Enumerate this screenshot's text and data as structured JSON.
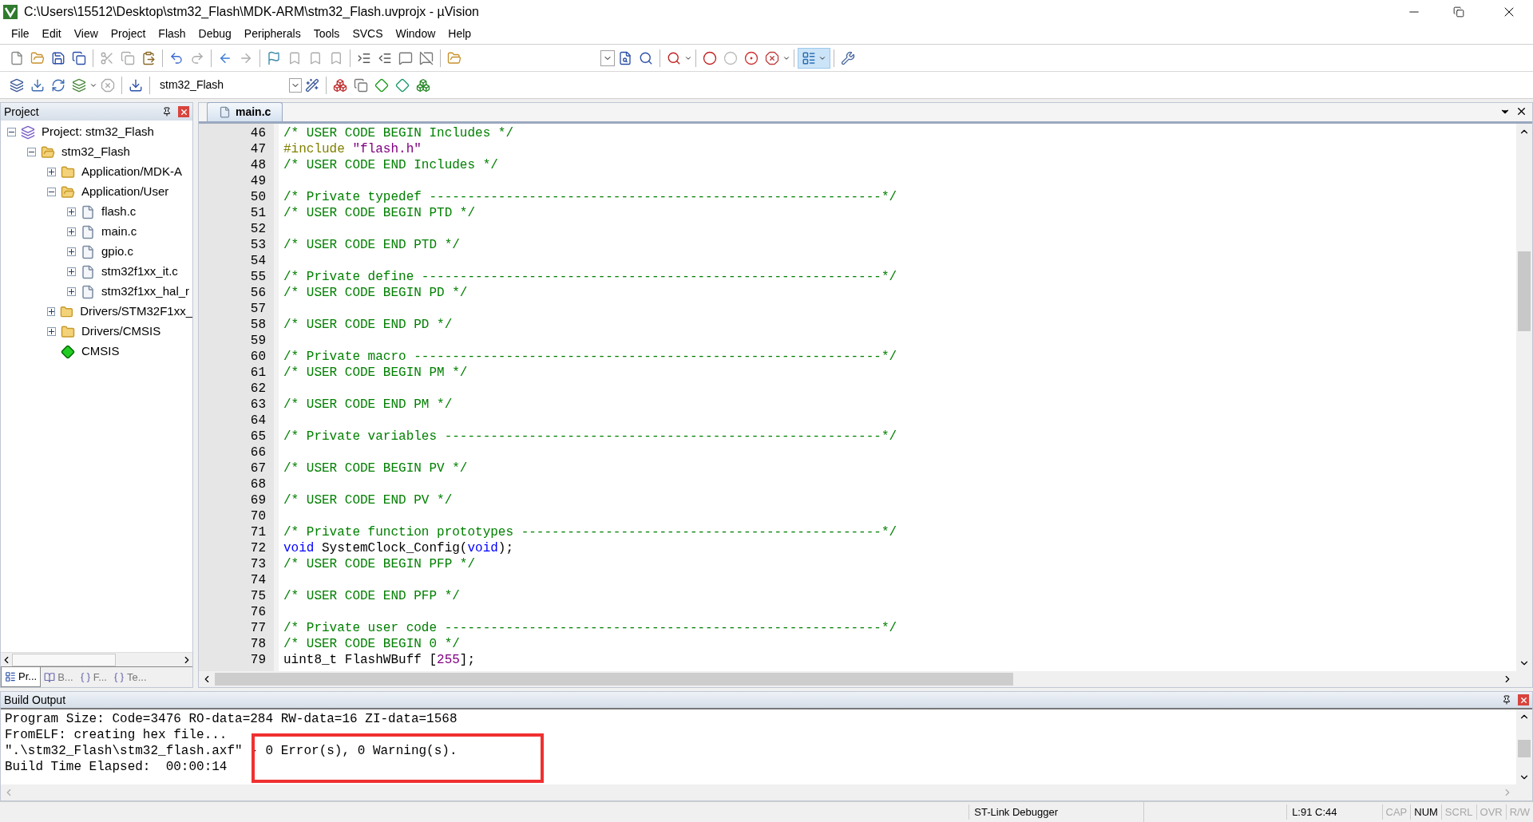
{
  "window": {
    "title": "C:\\Users\\15512\\Desktop\\stm32_Flash\\MDK-ARM\\stm32_Flash.uvprojx - µVision"
  },
  "menu": [
    "File",
    "Edit",
    "View",
    "Project",
    "Flash",
    "Debug",
    "Peripherals",
    "Tools",
    "SVCS",
    "Window",
    "Help"
  ],
  "toolbar": {
    "target": "stm32_Flash"
  },
  "project_panel": {
    "title": "Project",
    "tree": [
      {
        "kind": "project",
        "label": "Project: stm32_Flash",
        "expanded": true,
        "children": [
          {
            "kind": "target",
            "label": "stm32_Flash",
            "expanded": true,
            "children": [
              {
                "kind": "group",
                "label": "Application/MDK-A",
                "expanded": false
              },
              {
                "kind": "group",
                "label": "Application/User",
                "expanded": true,
                "children": [
                  {
                    "kind": "file",
                    "label": "flash.c",
                    "expanded": false
                  },
                  {
                    "kind": "file",
                    "label": "main.c",
                    "expanded": false
                  },
                  {
                    "kind": "file",
                    "label": "gpio.c",
                    "expanded": false
                  },
                  {
                    "kind": "file",
                    "label": "stm32f1xx_it.c",
                    "expanded": false
                  },
                  {
                    "kind": "file",
                    "label": "stm32f1xx_hal_r",
                    "expanded": false
                  }
                ]
              },
              {
                "kind": "group",
                "label": "Drivers/STM32F1xx_",
                "expanded": false
              },
              {
                "kind": "group",
                "label": "Drivers/CMSIS",
                "expanded": false
              },
              {
                "kind": "component",
                "label": "CMSIS"
              }
            ]
          }
        ]
      }
    ],
    "tabs": [
      {
        "kind": "project",
        "label": "Pr...",
        "selected": true
      },
      {
        "kind": "books",
        "label": "B...",
        "selected": false
      },
      {
        "kind": "functions",
        "label": "F...",
        "selected": false
      },
      {
        "kind": "templates",
        "label": "Te...",
        "selected": false
      }
    ]
  },
  "editor": {
    "tabs": [
      {
        "label": "main.c",
        "selected": true
      }
    ],
    "lines": [
      {
        "number": "46",
        "segments": [
          {
            "kind": "comment",
            "text": "/* USER CODE BEGIN Includes */"
          }
        ]
      },
      {
        "number": "47",
        "segments": [
          {
            "kind": "directive",
            "text": "#include "
          },
          {
            "kind": "string",
            "text": "\"flash.h\""
          }
        ]
      },
      {
        "number": "48",
        "segments": [
          {
            "kind": "comment",
            "text": "/* USER CODE END Includes */"
          }
        ]
      },
      {
        "number": "49"
      },
      {
        "number": "50",
        "segments": [
          {
            "kind": "comment",
            "text": "/* Private typedef -----------------------------------------------------------*/"
          }
        ]
      },
      {
        "number": "51",
        "segments": [
          {
            "kind": "comment",
            "text": "/* USER CODE BEGIN PTD */"
          }
        ]
      },
      {
        "number": "52"
      },
      {
        "number": "53",
        "segments": [
          {
            "kind": "comment",
            "text": "/* USER CODE END PTD */"
          }
        ]
      },
      {
        "number": "54"
      },
      {
        "number": "55",
        "segments": [
          {
            "kind": "comment",
            "text": "/* Private define ------------------------------------------------------------*/"
          }
        ]
      },
      {
        "number": "56",
        "segments": [
          {
            "kind": "comment",
            "text": "/* USER CODE BEGIN PD */"
          }
        ]
      },
      {
        "number": "57"
      },
      {
        "number": "58",
        "segments": [
          {
            "kind": "comment",
            "text": "/* USER CODE END PD */"
          }
        ]
      },
      {
        "number": "59"
      },
      {
        "number": "60",
        "segments": [
          {
            "kind": "comment",
            "text": "/* Private macro -------------------------------------------------------------*/"
          }
        ]
      },
      {
        "number": "61",
        "segments": [
          {
            "kind": "comment",
            "text": "/* USER CODE BEGIN PM */"
          }
        ]
      },
      {
        "number": "62"
      },
      {
        "number": "63",
        "segments": [
          {
            "kind": "comment",
            "text": "/* USER CODE END PM */"
          }
        ]
      },
      {
        "number": "64"
      },
      {
        "number": "65",
        "segments": [
          {
            "kind": "comment",
            "text": "/* Private variables ---------------------------------------------------------*/"
          }
        ]
      },
      {
        "number": "66"
      },
      {
        "number": "67",
        "segments": [
          {
            "kind": "comment",
            "text": "/* USER CODE BEGIN PV */"
          }
        ]
      },
      {
        "number": "68"
      },
      {
        "number": "69",
        "segments": [
          {
            "kind": "comment",
            "text": "/* USER CODE END PV */"
          }
        ]
      },
      {
        "number": "70"
      },
      {
        "number": "71",
        "segments": [
          {
            "kind": "comment",
            "text": "/* Private function prototypes -----------------------------------------------*/"
          }
        ]
      },
      {
        "number": "72",
        "segments": [
          {
            "kind": "keyword",
            "text": "void"
          },
          {
            "kind": "plain",
            "text": " SystemClock_Config("
          },
          {
            "kind": "keyword",
            "text": "void"
          },
          {
            "kind": "plain",
            "text": ");"
          }
        ]
      },
      {
        "number": "73",
        "segments": [
          {
            "kind": "comment",
            "text": "/* USER CODE BEGIN PFP */"
          }
        ]
      },
      {
        "number": "74"
      },
      {
        "number": "75",
        "segments": [
          {
            "kind": "comment",
            "text": "/* USER CODE END PFP */"
          }
        ]
      },
      {
        "number": "76"
      },
      {
        "number": "77",
        "segments": [
          {
            "kind": "comment",
            "text": "/* Private user code ---------------------------------------------------------*/"
          }
        ]
      },
      {
        "number": "78",
        "segments": [
          {
            "kind": "comment",
            "text": "/* USER CODE BEGIN 0 */"
          }
        ]
      },
      {
        "number": "79",
        "segments": [
          {
            "kind": "plain",
            "text": "uint8_t FlashWBuff ["
          },
          {
            "kind": "number",
            "text": "255"
          },
          {
            "kind": "plain",
            "text": "];"
          }
        ]
      }
    ]
  },
  "build_output": {
    "title": "Build Output",
    "lines": [
      "Program Size: Code=3476 RO-data=284 RW-data=16 ZI-data=1568",
      "FromELF: creating hex file...",
      "\".\\stm32_Flash\\stm32_flash.axf\" - 0 Error(s), 0 Warning(s).",
      "Build Time Elapsed:  00:00:14"
    ]
  },
  "status_bar": {
    "debugger": "ST-Link Debugger",
    "position": "L:91 C:44",
    "indicators": [
      {
        "label": "CAP",
        "on": false
      },
      {
        "label": "NUM",
        "on": true
      },
      {
        "label": "SCRL",
        "on": false
      },
      {
        "label": "OVR",
        "on": false
      },
      {
        "label": "R/W",
        "on": false
      }
    ]
  }
}
